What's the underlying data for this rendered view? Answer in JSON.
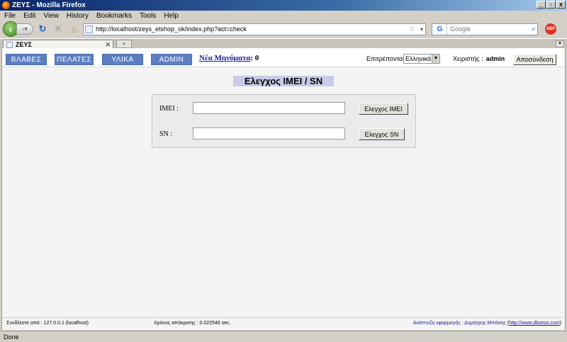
{
  "window": {
    "title": "ΖΕΥΣ - Mozilla Firefox",
    "minimize": "_",
    "maximize": "▫",
    "close": "x"
  },
  "menu": [
    "File",
    "Edit",
    "View",
    "History",
    "Bookmarks",
    "Tools",
    "Help"
  ],
  "nav": {
    "url": "http://localhost/zeys_etshop_ok/index.php?act=check",
    "search_placeholder": "Google",
    "search_engine": "G",
    "addon": "ABP"
  },
  "tabs": [
    {
      "label": "ΖΕΥΣ"
    }
  ],
  "new_tab": "+",
  "page": {
    "nav_buttons": [
      "ΒΛΑΒΕΣ",
      "ΠΕΛΑΤΕΣ",
      "ΥΛΙΚΑ",
      "ADMIN"
    ],
    "new_messages_label": "Νέα Μηνύματα",
    "new_messages_colon": ":",
    "new_messages_count": "0",
    "language_label": "Επιτρέπονται :",
    "language_selected": "Ελληνικά",
    "user_label": "Χειριστής :",
    "user_name": "admin",
    "logout": "Αποσύνδεση",
    "heading": "Ελεγχος IMEI / SN",
    "form": {
      "imei_label": "IMEI :",
      "imei_value": "",
      "imei_button": "Ελεγχος IMEI",
      "sn_label": "SN :",
      "sn_value": "",
      "sn_button": "Ελεγχος SN"
    },
    "footer": {
      "connected": "Συνδέεστε από : 127.0.0.1 (localhost)",
      "response_time": "Χρόνος απόκρισης : 0.022549 sec.",
      "dev_label": "Ανάπτυξη εφαρμογής : Δημήτρης Μπόσης",
      "dev_link": "http://www.dbotsis.com",
      "dev_paren_open": "(",
      "dev_paren_close": ")"
    }
  },
  "status": "Done"
}
